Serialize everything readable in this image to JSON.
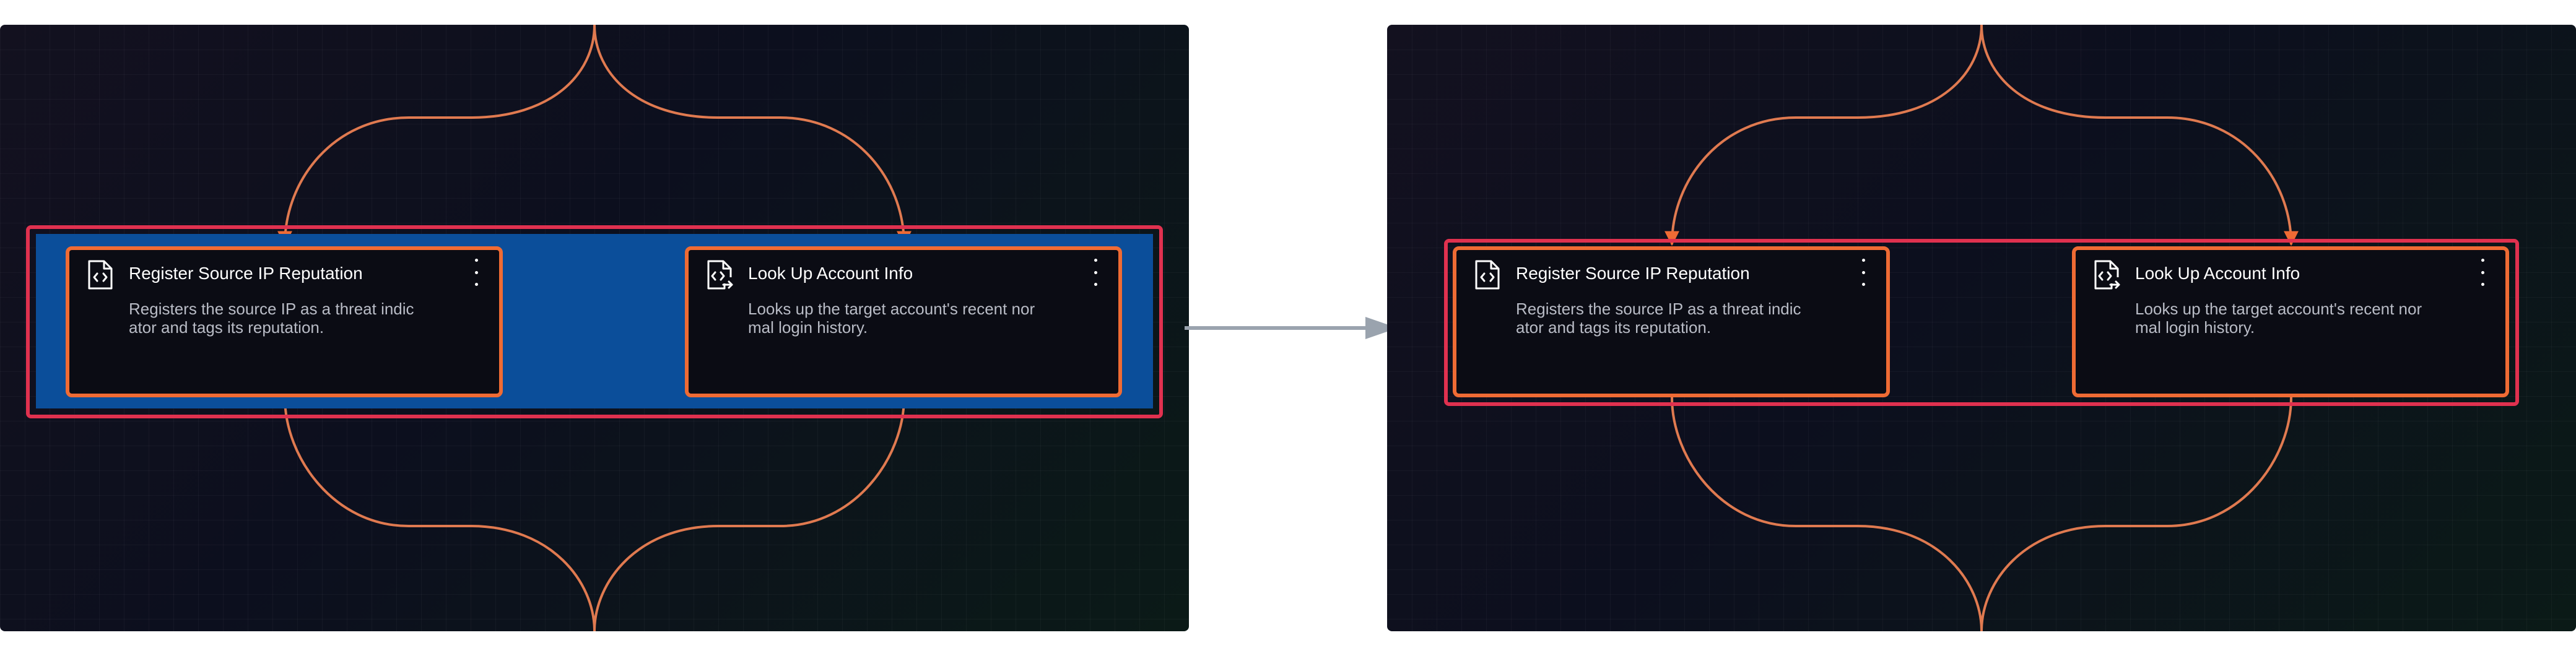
{
  "colors": {
    "canvas_background": "#0f1020",
    "edge": "#e07a50",
    "edge_arrowhead": "#ef6b34",
    "node_border": "#ef6b34",
    "group_border": "#e0314f",
    "selection_fill": "#0b4e9a",
    "transition_arrow": "#9aa3ae"
  },
  "panels": {
    "before": {
      "group_selected": true,
      "nodes": [
        {
          "icon": "script-file-icon",
          "title": "Register Source IP Reputation",
          "description": "Registers the source IP as a threat indic\nator and tags its reputation."
        },
        {
          "icon": "script-file-export-icon",
          "title": "Look Up Account Info",
          "description": "Looks up the target account's recent nor\nmal login history."
        }
      ]
    },
    "after": {
      "group_selected": false,
      "nodes": [
        {
          "icon": "script-file-icon",
          "title": "Register Source IP Reputation",
          "description": "Registers the source IP as a threat indic\nator and tags its reputation."
        },
        {
          "icon": "script-file-export-icon",
          "title": "Look Up Account Info",
          "description": "Looks up the target account's recent nor\nmal login history."
        }
      ]
    }
  },
  "transition": {
    "icon": "right-arrow-icon"
  }
}
